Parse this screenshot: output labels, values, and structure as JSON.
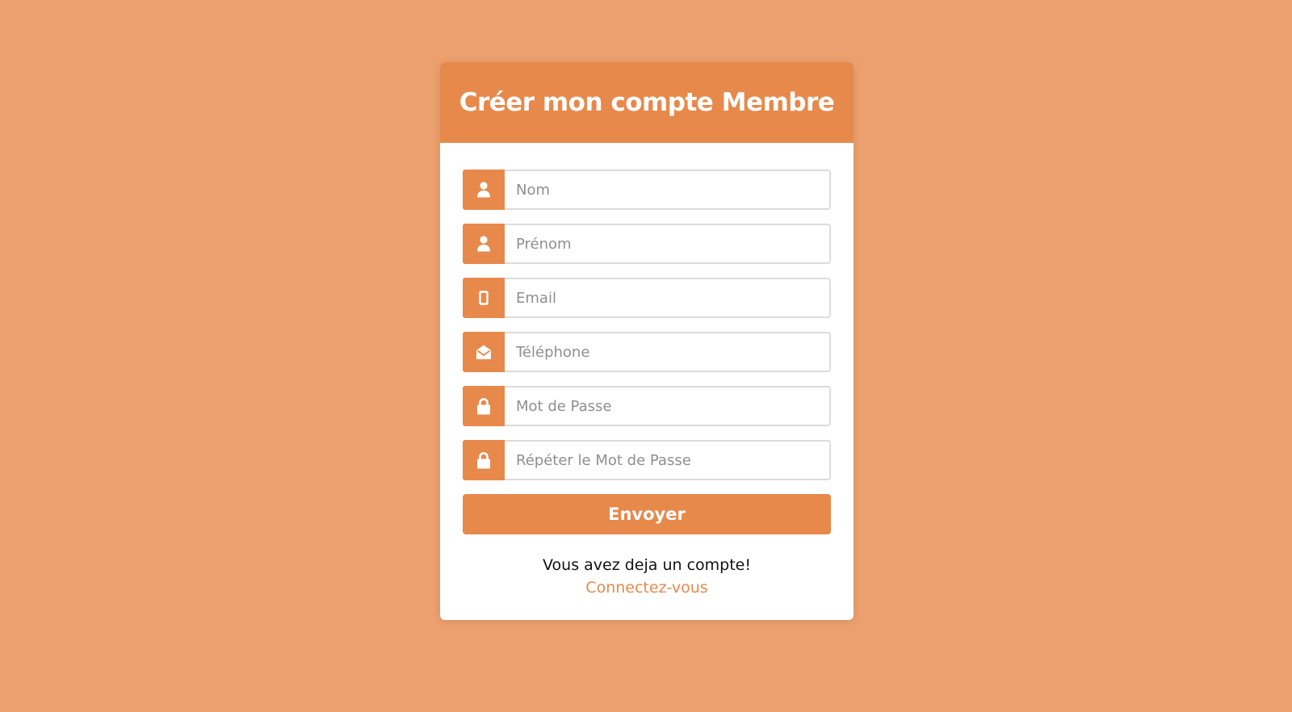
{
  "colors": {
    "background": "#eca06e",
    "accent": "#e7894b",
    "card": "#ffffff"
  },
  "form": {
    "title": "Créer mon compte Membre",
    "fields": [
      {
        "icon": "user-icon",
        "placeholder": "Nom",
        "value": ""
      },
      {
        "icon": "user-icon",
        "placeholder": "Prénom",
        "value": ""
      },
      {
        "icon": "mobile-phone-icon",
        "placeholder": "Email",
        "value": ""
      },
      {
        "icon": "envelope-open-icon",
        "placeholder": "Téléphone",
        "value": ""
      },
      {
        "icon": "lock-icon",
        "placeholder": "Mot de Passe",
        "value": ""
      },
      {
        "icon": "lock-icon",
        "placeholder": "Répéter le Mot de Passe",
        "value": ""
      }
    ],
    "submit_label": "Envoyer",
    "footer_text": "Vous avez deja un compte!",
    "login_link": "Connectez-vous"
  }
}
